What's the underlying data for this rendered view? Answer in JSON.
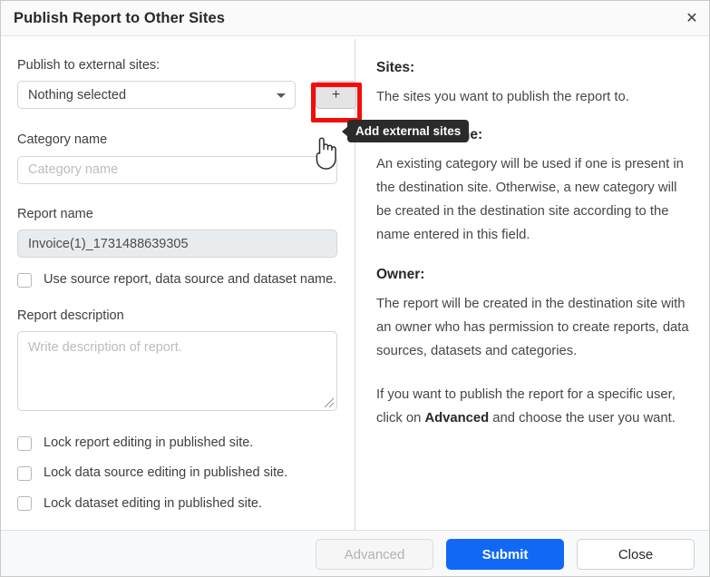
{
  "window": {
    "title": "Publish Report to Other Sites",
    "close_icon": "close-icon",
    "close_glyph": "✕"
  },
  "form": {
    "publish_label": "Publish to external sites:",
    "select_value": "Nothing selected",
    "select_caret_icon": "chevron-down-icon",
    "add_button_label": "+",
    "add_button_icon": "plus-icon",
    "category_label": "Category name",
    "category_placeholder": "Category name",
    "category_value": "",
    "report_name_label": "Report name",
    "report_name_value": "Invoice(1)_1731488639305",
    "use_source_checkbox": "Use source report, data source and dataset name.",
    "report_desc_label": "Report description",
    "report_desc_placeholder": "Write description of report.",
    "report_desc_value": "",
    "resize_grip_icon": "resize-grip-icon",
    "lock_options": [
      "Lock report editing in published site.",
      "Lock data source editing in published site.",
      "Lock dataset editing in published site."
    ]
  },
  "tooltip": {
    "text": "Add external sites",
    "arrow_icon": "tooltip-arrow-icon"
  },
  "cursor": {
    "icon": "pointing-hand-cursor"
  },
  "help": {
    "sites_heading": "Sites:",
    "sites_text": "The sites you want to publish the report to.",
    "category_heading": "Category name:",
    "category_text": "An existing category will be used if one is present in the destination site. Otherwise, a new category will be created in the destination site according to the name entered in this field.",
    "owner_heading": "Owner:",
    "owner_text": "The report will be created in the destination site with an owner who has permission to create reports, data sources, datasets and categories.",
    "advanced_text_before": "If you want to publish the report for a specific user, click on ",
    "advanced_text_bold": "Advanced",
    "advanced_text_after": " and choose the user you want."
  },
  "footer": {
    "advanced_label": "Advanced",
    "submit_label": "Submit",
    "close_label": "Close"
  },
  "colors": {
    "accent_blue": "#1168f7",
    "highlight_red": "#f40c0c",
    "tooltip_bg": "#2b2b2b",
    "footer_bg": "#f8f9fa",
    "header_bg": "#fafafa"
  }
}
